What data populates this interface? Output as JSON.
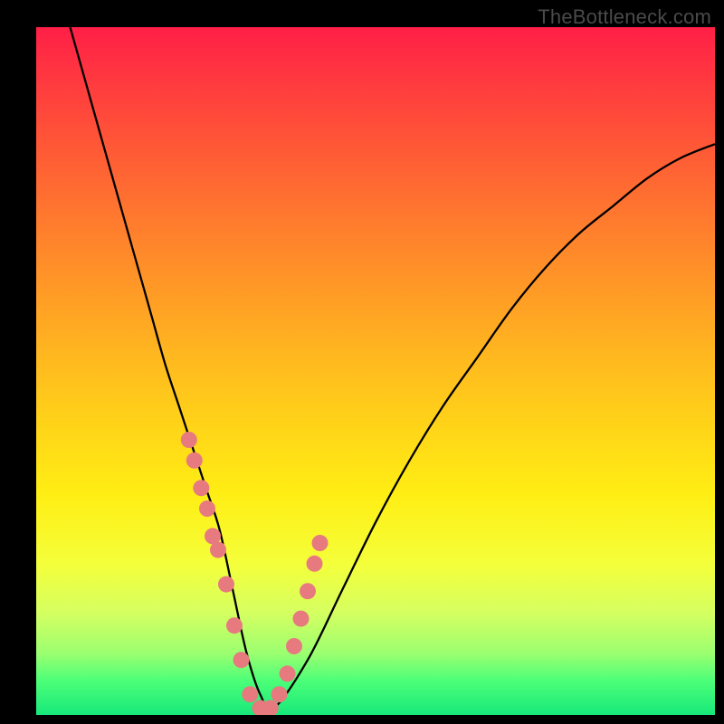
{
  "watermark": "TheBottleneck.com",
  "chart_data": {
    "type": "line",
    "title": "",
    "xlabel": "",
    "ylabel": "",
    "xlim": [
      0,
      100
    ],
    "ylim": [
      0,
      100
    ],
    "grid": false,
    "legend": false,
    "series": [
      {
        "name": "bottleneck-curve",
        "x": [
          5,
          7,
          9,
          11,
          13,
          15,
          17,
          19,
          21,
          23,
          25,
          27,
          29,
          31,
          33,
          35,
          40,
          45,
          50,
          55,
          60,
          65,
          70,
          75,
          80,
          85,
          90,
          95,
          100
        ],
        "y": [
          100,
          93,
          86,
          79,
          72,
          65,
          58,
          51,
          45,
          39,
          33,
          27,
          18,
          9,
          3,
          1,
          8,
          18,
          28,
          37,
          45,
          52,
          59,
          65,
          70,
          74,
          78,
          81,
          83
        ]
      }
    ],
    "markers": {
      "name": "highlight-dots",
      "x": [
        22.5,
        23.3,
        24.3,
        25.2,
        26.0,
        26.8,
        28.0,
        29.2,
        30.2,
        31.5,
        33.0,
        34.5,
        35.8,
        37.0,
        38.0,
        39.0,
        40.0,
        41.0,
        41.8
      ],
      "y": [
        40,
        37,
        33,
        30,
        26,
        24,
        19,
        13,
        8,
        3,
        1,
        1,
        3,
        6,
        10,
        14,
        18,
        22,
        25
      ]
    },
    "background_gradient": {
      "top": "#ff1f47",
      "bottom": "#17e87a"
    }
  }
}
